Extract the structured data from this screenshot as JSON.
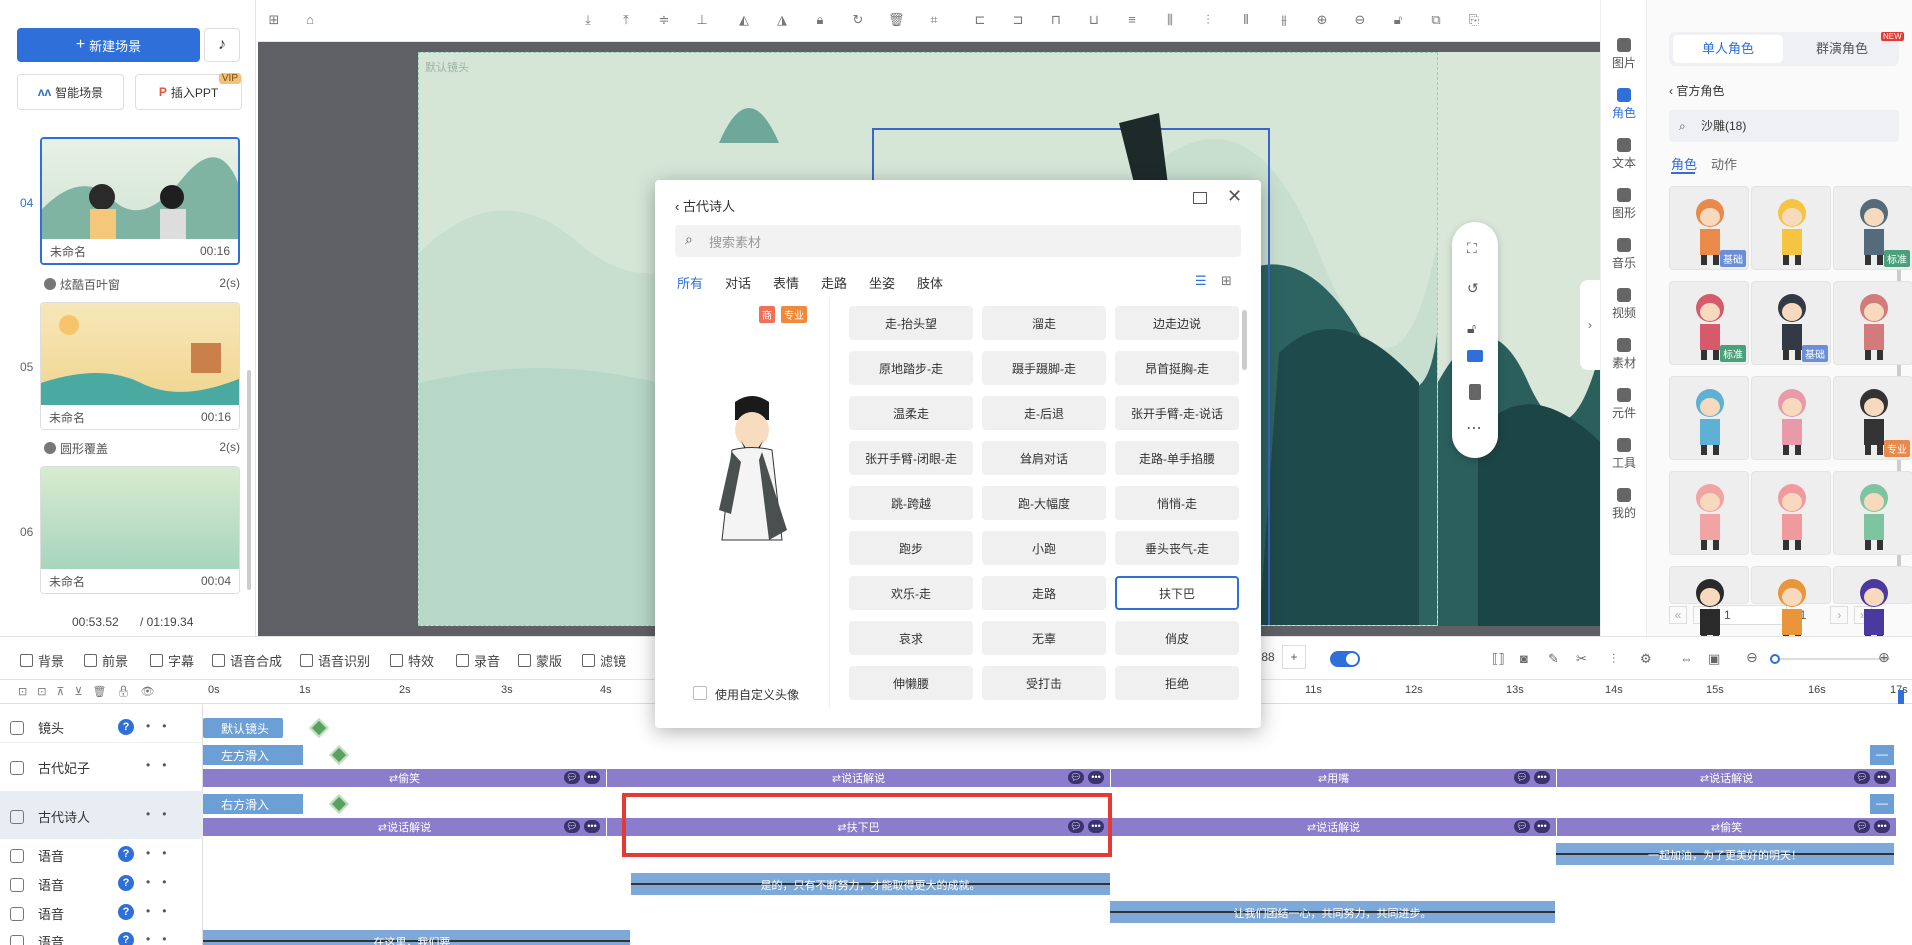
{
  "left": {
    "new_scene": "新建场景",
    "smart_scene": "智能场景",
    "insert_ppt": "插入PPT",
    "vip": "VIP",
    "scenes": [
      {
        "num": "04",
        "name": "未命名",
        "dur": "00:16",
        "trans": "炫酷百叶窗",
        "trans_dur": "2(s)"
      },
      {
        "num": "05",
        "name": "未命名",
        "dur": "00:16",
        "trans": "圆形覆盖",
        "trans_dur": "2(s)"
      },
      {
        "num": "06",
        "name": "未命名",
        "dur": "00:04"
      }
    ],
    "time_current": "00:53.52",
    "time_total": "/ 01:19.34"
  },
  "stage": {
    "camera_label": "默认镜头"
  },
  "rail": [
    "图片",
    "角色",
    "文本",
    "图形",
    "音乐",
    "视频",
    "素材",
    "元件",
    "工具",
    "我的"
  ],
  "rpanel": {
    "tab_single": "单人角色",
    "tab_group": "群演角色",
    "new_badge": "NEW",
    "official": "官方角色",
    "search_value": "沙雕(18)",
    "sub_tab_role": "角色",
    "sub_tab_action": "动作",
    "badges": [
      "基础",
      "",
      "标准",
      "标准",
      "基础",
      "",
      "",
      "",
      "专业",
      "",
      "",
      "",
      "",
      "",
      ""
    ],
    "pager": "1",
    "pager_total": "/ 1"
  },
  "dialog": {
    "back": "古代诗人",
    "search_placeholder": "搜索素材",
    "tabs": [
      "所有",
      "对话",
      "表情",
      "走路",
      "坐姿",
      "肢体"
    ],
    "tag_commercial": "商",
    "tag_pro": "专业",
    "custom_avatar": "使用自定义头像",
    "actions": [
      "走-抬头望",
      "溜走",
      "边走边说",
      "原地踏步-走",
      "蹑手蹑脚-走",
      "昂首挺胸-走",
      "温柔走",
      "走-后退",
      "张开手臂-走-说话",
      "张开手臂-闭眼-走",
      "耸肩对话",
      "走路-单手掐腰",
      "跳-跨越",
      "跑-大幅度",
      "悄悄-走",
      "跑步",
      "小跑",
      "垂头丧气-走",
      "欢乐-走",
      "走路",
      "扶下巴",
      "哀求",
      "无辜",
      "俏皮",
      "伸懒腰",
      "受打击",
      "拒绝"
    ]
  },
  "timeline": {
    "tools": [
      "背景",
      "前景",
      "字幕",
      "语音合成",
      "语音识别",
      "特效",
      "录音",
      "蒙版",
      "滤镜"
    ],
    "zoom_value": ".88",
    "ruler": [
      "0s",
      "1s",
      "2s",
      "3s",
      "4s",
      "11s",
      "12s",
      "13s",
      "14s",
      "15s",
      "16s",
      "17s"
    ],
    "tracks": {
      "camera": "镜头",
      "fei": "古代妃子",
      "poet": "古代诗人",
      "voice": "语音"
    },
    "clips": {
      "default_camera": "默认镜头",
      "left_in": "左方滑入",
      "right_in": "右方滑入",
      "fei_actions": [
        "偷笑",
        "说话解说",
        "用嘴",
        "说话解说"
      ],
      "poet_actions": [
        "说话解说",
        "扶下巴",
        "说话解说",
        "偷笑"
      ]
    },
    "audio_texts": [
      "一起加油，为了更美好的明天！",
      "是的，只有不断努力，才能取得更大的成就。",
      "让我们团结一心，共同努力，共同进步。",
      "在这里，我们要..."
    ]
  }
}
